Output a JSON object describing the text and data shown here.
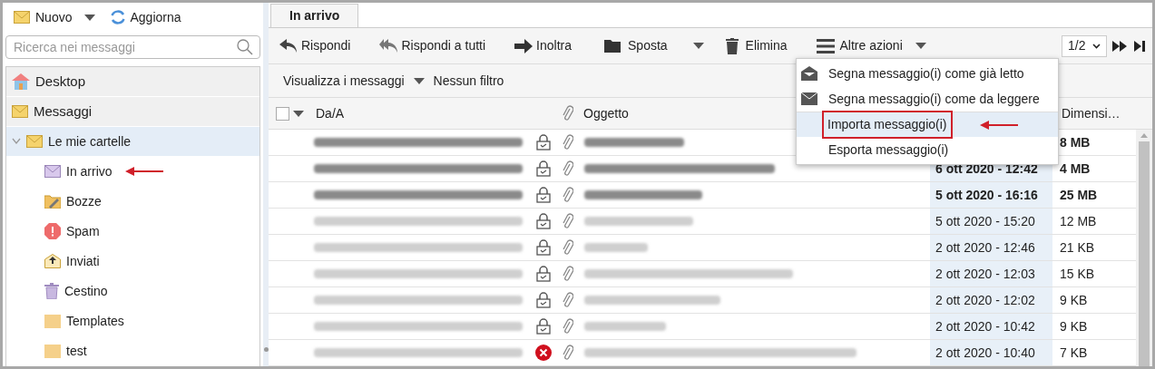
{
  "left_toolbar": {
    "new_label": "Nuovo",
    "refresh_label": "Aggiorna"
  },
  "search": {
    "placeholder": "Ricerca nei messaggi"
  },
  "sidebar": {
    "items": [
      {
        "label": "Desktop",
        "kind": "home",
        "selected": false
      },
      {
        "label": "Messaggi",
        "kind": "mail",
        "selected": false
      },
      {
        "label": "Le mie cartelle",
        "kind": "mail",
        "selected": true,
        "expanded": true,
        "children": [
          {
            "label": "In arrivo",
            "kind": "inbox",
            "selected": false,
            "arrow": true
          },
          {
            "label": "Bozze",
            "kind": "drafts",
            "selected": false
          },
          {
            "label": "Spam",
            "kind": "spam",
            "selected": false
          },
          {
            "label": "Inviati",
            "kind": "sent",
            "selected": false
          },
          {
            "label": "Cestino",
            "kind": "trash",
            "selected": false
          },
          {
            "label": "Templates",
            "kind": "folder",
            "selected": false
          },
          {
            "label": "test",
            "kind": "folder",
            "selected": false
          }
        ]
      }
    ]
  },
  "tabs": [
    {
      "label": "In arrivo",
      "selected": true
    }
  ],
  "toolbar": {
    "reply": "Rispondi",
    "reply_all": "Rispondi a tutti",
    "forward": "Inoltra",
    "move": "Sposta",
    "delete": "Elimina",
    "more": "Altre azioni",
    "page": "1/2"
  },
  "filter_bar": {
    "view": "Visualizza i messaggi",
    "filter": "Nessun filtro"
  },
  "table": {
    "select_all_checked": false,
    "columns": [
      "Da/A",
      "Oggetto",
      "Dimensi…"
    ],
    "rows": [
      {
        "unread": true,
        "kind": "lock",
        "size": "8 MB"
      },
      {
        "unread": true,
        "kind": "lock",
        "date": "6 ott 2020 - 12:42",
        "size": "4 MB"
      },
      {
        "unread": true,
        "kind": "lock",
        "date": "5 ott 2020 - 16:16",
        "size": "25 MB"
      },
      {
        "unread": false,
        "kind": "lock",
        "date": "5 ott 2020 - 15:20",
        "size": "12 MB"
      },
      {
        "unread": false,
        "kind": "lock",
        "date": "2 ott 2020 - 12:46",
        "size": "21 KB"
      },
      {
        "unread": false,
        "kind": "lock",
        "date": "2 ott 2020 - 12:03",
        "size": "15 KB"
      },
      {
        "unread": false,
        "kind": "lock",
        "date": "2 ott 2020 - 12:02",
        "size": "9 KB"
      },
      {
        "unread": false,
        "kind": "lock",
        "date": "2 ott 2020 - 10:42",
        "size": "9 KB"
      },
      {
        "unread": false,
        "kind": "error",
        "date": "2 ott 2020 - 10:40",
        "size": "7 KB"
      }
    ]
  },
  "menu": {
    "items": [
      {
        "label": "Segna messaggio(i) come già letto",
        "kind": "read",
        "selected": false
      },
      {
        "label": "Segna messaggio(i) come da leggere",
        "kind": "unread",
        "selected": false
      },
      {
        "label": "Importa messaggio(i)",
        "kind": "none",
        "selected": true,
        "highlighted": true
      },
      {
        "label": "Esporta messaggio(i)",
        "kind": "none",
        "selected": false
      }
    ]
  }
}
